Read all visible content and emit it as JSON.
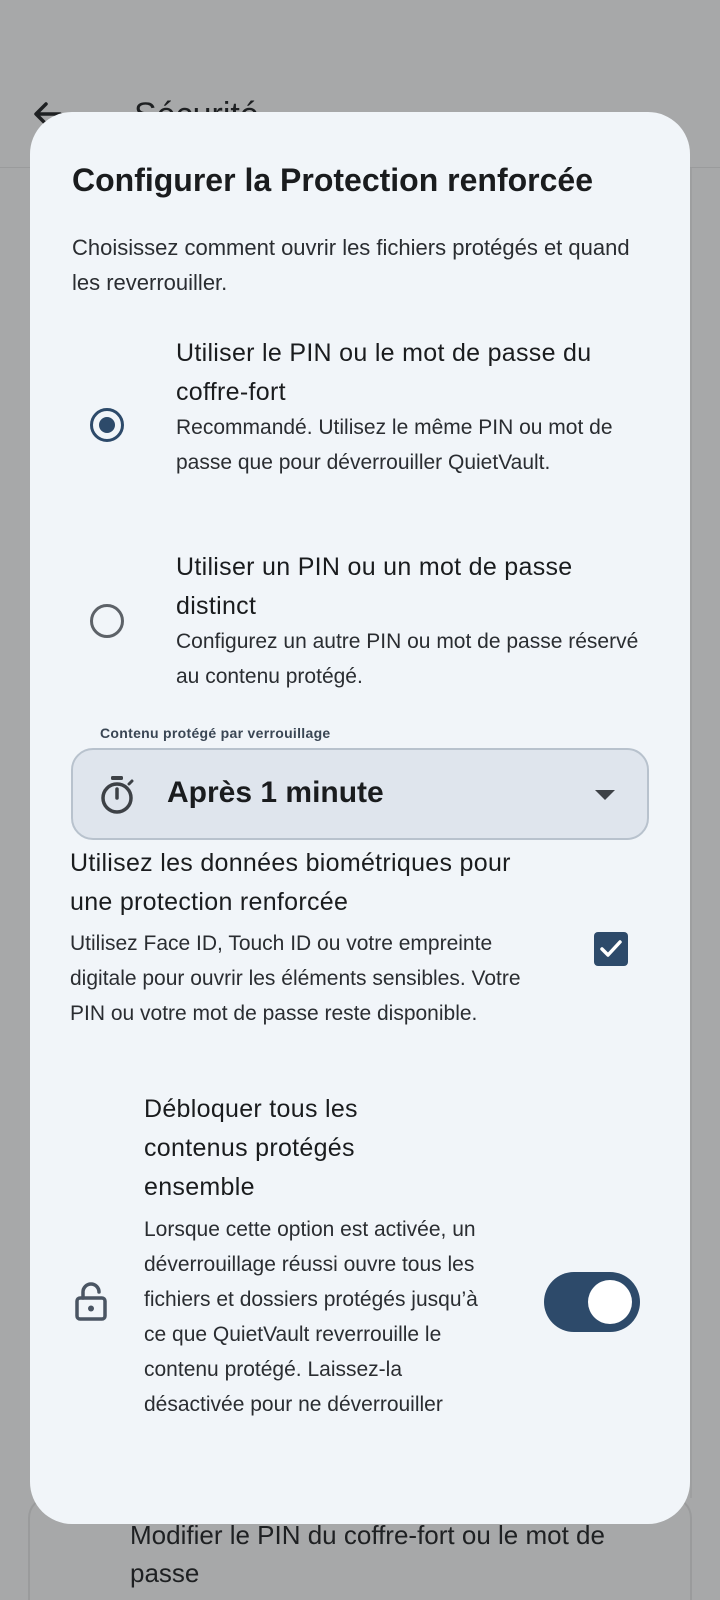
{
  "background": {
    "title": "Sécurité",
    "card_text": "Modifier le PIN du coffre-fort ou le mot de passe"
  },
  "dialog": {
    "title": "Configurer la Protection renforcée",
    "description": "Choisissez comment ouvrir les fichiers protégés et quand les reverrouiller.",
    "options": [
      {
        "title": "Utiliser le PIN ou le mot de passe du coffre-fort",
        "subtitle": "Recommandé. Utilisez le même PIN ou mot de passe que pour déverrouiller QuietVault.",
        "selected": true
      },
      {
        "title": "Utiliser un PIN ou un mot de passe distinct",
        "subtitle": "Configurez un autre PIN ou mot de passe réservé au contenu protégé.",
        "selected": false
      }
    ],
    "lock_select": {
      "label": "Contenu protégé par verrouillage",
      "value": "Après 1 minute",
      "icon": "timer-icon"
    },
    "biometrics": {
      "title": "Utilisez les données biométriques pour une protection renforcée",
      "subtitle": "Utilisez Face ID, Touch ID ou votre empreinte digitale pour ouvrir les éléments sensibles. Votre PIN ou votre mot de passe reste disponible.",
      "checked": true
    },
    "unlock_all": {
      "title": "Débloquer tous les contenus protégés ensemble",
      "subtitle": "Lorsque cette option est activée, un déverrouillage réussi ouvre tous les fichiers et dossiers protégés jusqu’à ce que QuietVault reverrouille le contenu protégé. Laissez-la désactivée pour ne déverrouiller",
      "enabled": true,
      "icon": "lock-icon"
    }
  },
  "colors": {
    "accent": "#2d4a6a",
    "dialog_bg": "#f1f5f9",
    "scrim": "#a7a8a9"
  }
}
